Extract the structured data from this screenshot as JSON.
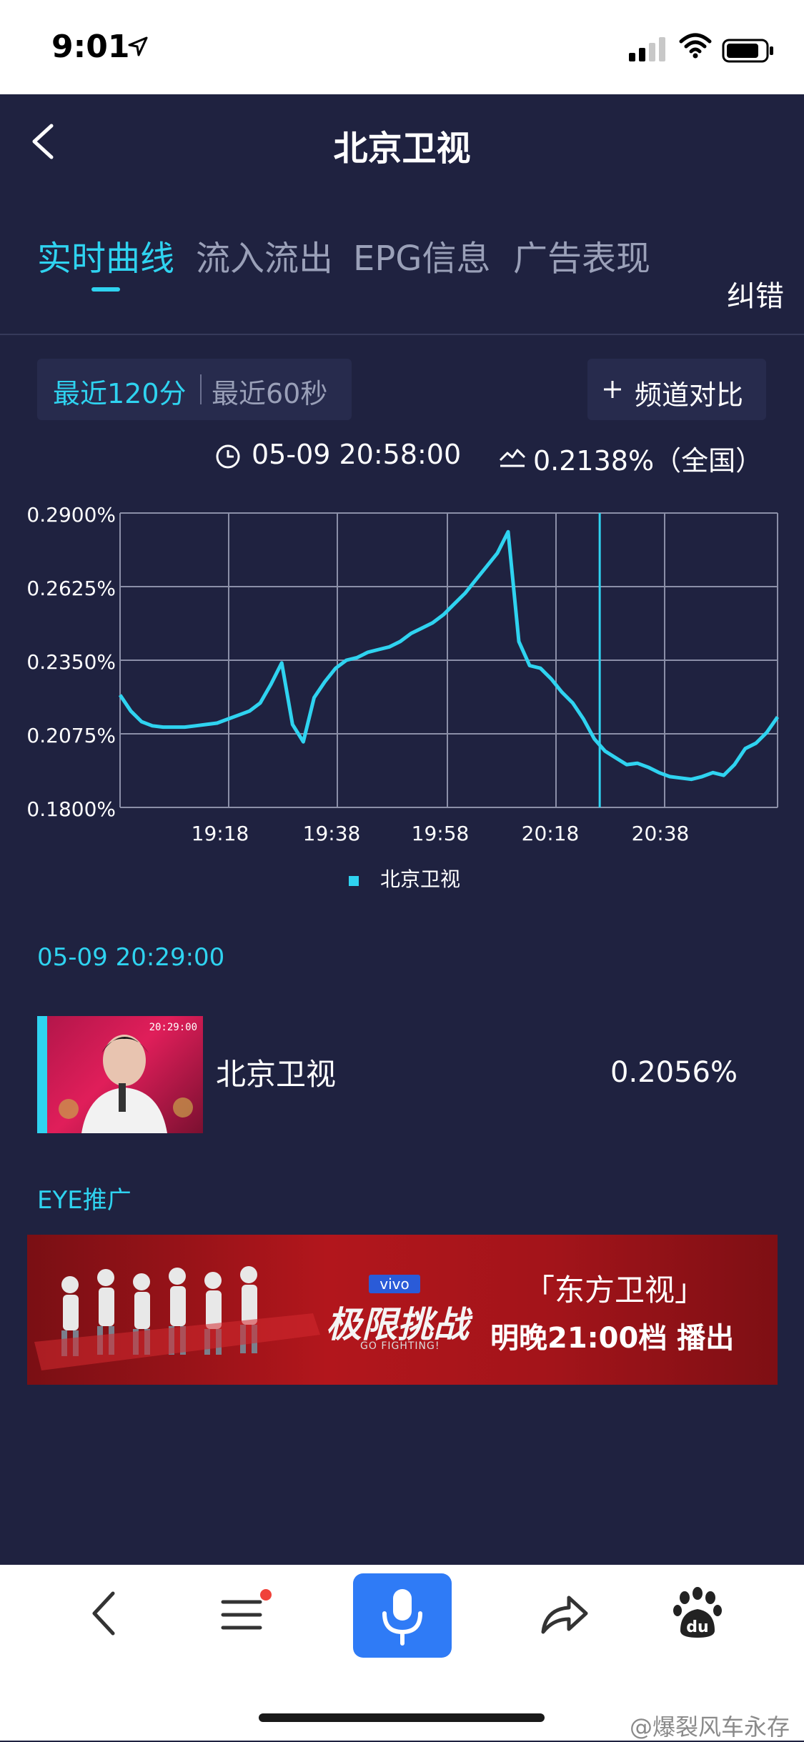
{
  "status": {
    "time": "9:01"
  },
  "nav": {
    "title": "北京卫视"
  },
  "tabs": [
    "实时曲线",
    "流入流出",
    "EPG信息",
    "广告表现"
  ],
  "correction_label": "纠错",
  "range": {
    "option_a": "最近120分",
    "option_b": "最近60秒",
    "selected": "最近120分"
  },
  "compare_label": "频道对比",
  "info": {
    "time": "05-09  20:58:00",
    "rating": "0.2138%（全国）"
  },
  "colors": {
    "accent": "#2fd3f0",
    "background": "#1f2240"
  },
  "chart_data": {
    "type": "line",
    "y_ticks": [
      "0.2900%",
      "0.2625%",
      "0.2350%",
      "0.2075%",
      "0.1800%"
    ],
    "ylim": [
      0.18,
      0.29
    ],
    "x_ticks": [
      "19:18",
      "19:38",
      "19:58",
      "20:18",
      "20:38"
    ],
    "x_range_minutes": [
      1140,
      1262
    ],
    "cursor_time": "20:29",
    "legend_position": "bottom-center",
    "grid": true,
    "series": [
      {
        "name": "北京卫视",
        "color": "#2fd3f0",
        "x": [
          "19:00",
          "19:02",
          "19:04",
          "19:06",
          "19:08",
          "19:10",
          "19:12",
          "19:14",
          "19:16",
          "19:18",
          "19:20",
          "19:22",
          "19:24",
          "19:26",
          "19:28",
          "19:30",
          "19:32",
          "19:34",
          "19:36",
          "19:38",
          "19:40",
          "19:42",
          "19:44",
          "19:46",
          "19:48",
          "19:50",
          "19:52",
          "19:54",
          "19:56",
          "19:58",
          "20:00",
          "20:02",
          "20:04",
          "20:06",
          "20:08",
          "20:10",
          "20:12",
          "20:14",
          "20:16",
          "20:18",
          "20:20",
          "20:22",
          "20:24",
          "20:26",
          "20:28",
          "20:30",
          "20:32",
          "20:34",
          "20:36",
          "20:38",
          "20:40",
          "20:42",
          "20:44",
          "20:46",
          "20:48",
          "20:50",
          "20:52",
          "20:54",
          "20:56",
          "20:58",
          "21:00",
          "21:02"
        ],
        "values": [
          0.222,
          0.216,
          0.212,
          0.2105,
          0.21,
          0.21,
          0.21,
          0.2105,
          0.211,
          0.2115,
          0.213,
          0.2145,
          0.216,
          0.219,
          0.226,
          0.234,
          0.211,
          0.2045,
          0.221,
          0.227,
          0.232,
          0.235,
          0.236,
          0.238,
          0.239,
          0.24,
          0.242,
          0.245,
          0.247,
          0.249,
          0.252,
          0.256,
          0.26,
          0.265,
          0.27,
          0.275,
          0.283,
          0.242,
          0.233,
          0.232,
          0.228,
          0.223,
          0.219,
          0.213,
          0.2056,
          0.201,
          0.1985,
          0.196,
          0.1965,
          0.195,
          0.193,
          0.1915,
          0.191,
          0.1905,
          0.1915,
          0.193,
          0.192,
          0.196,
          0.202,
          0.204,
          0.208,
          0.2138
        ]
      }
    ]
  },
  "snapshot": {
    "time": "05-09  20:29:00",
    "channel": "北京卫视",
    "rating": "0.2056%",
    "thumb_time": "20:29:00"
  },
  "promo": {
    "label": "EYE推广",
    "banner": {
      "badge": "vivo",
      "show": "极限挑战",
      "show_sub": "GO FIGHTING!",
      "channel": "「东方卫视」",
      "airtime": "明晚21:00档 播出"
    }
  },
  "watermark": "@爆裂风车永存"
}
